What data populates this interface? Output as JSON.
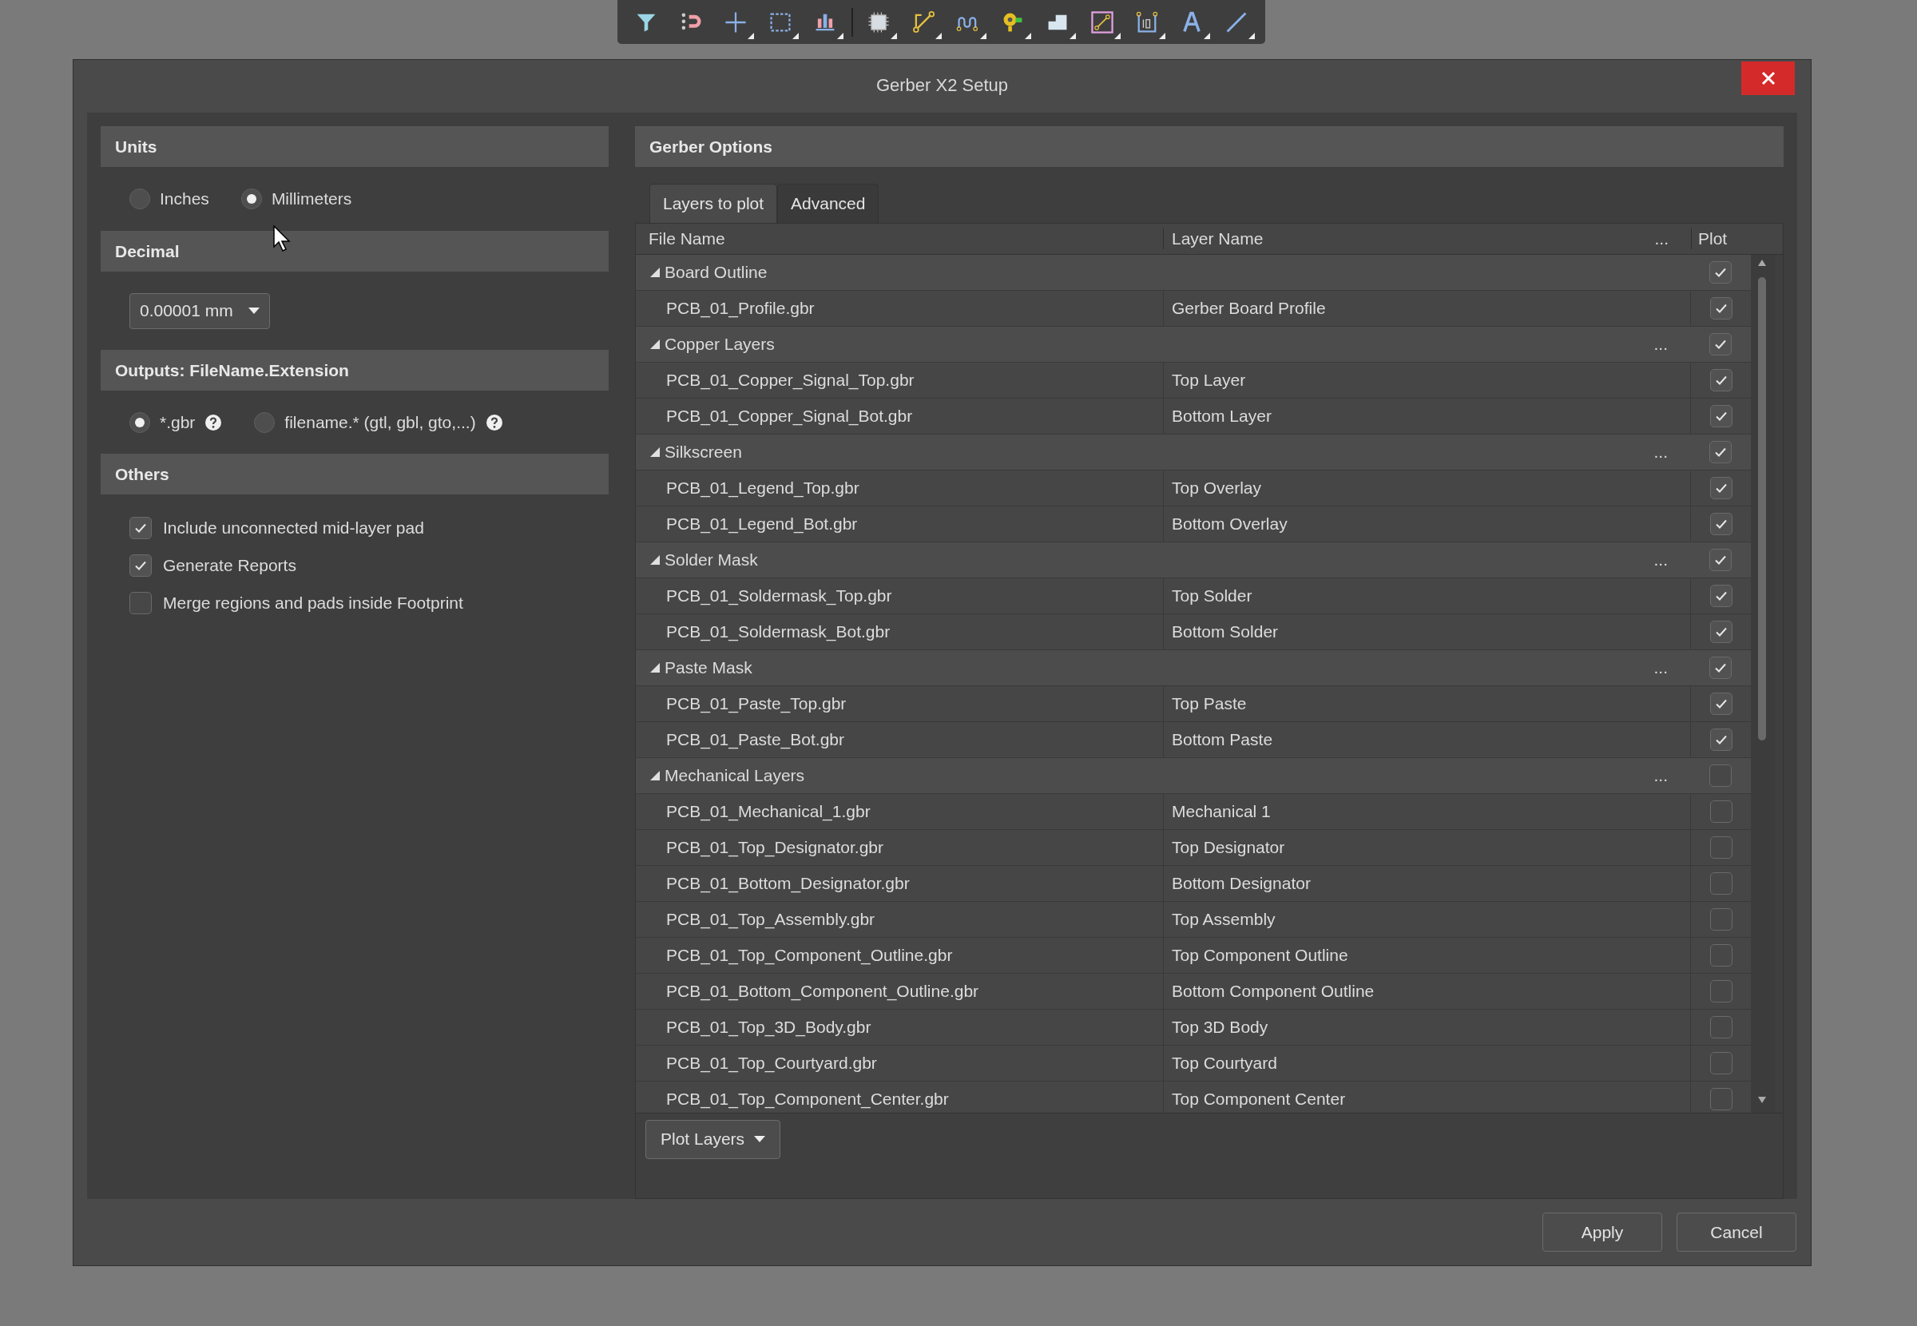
{
  "window": {
    "title": "Gerber X2 Setup"
  },
  "options": {
    "sections": [
      {
        "title": "Units",
        "kind": "radios",
        "options": [
          {
            "label": "Inches",
            "selected": false
          },
          {
            "label": "Millimeters",
            "selected": true
          }
        ]
      },
      {
        "title": "Decimal",
        "kind": "dropdown",
        "value": "0.00001 mm"
      },
      {
        "title": "Outputs: FileName.Extension",
        "kind": "radios",
        "options": [
          {
            "label": "*.gbr",
            "selected": true,
            "help": true
          },
          {
            "label": "filename.* (gtl, gbl, gto,...)",
            "selected": false,
            "help": true
          }
        ]
      },
      {
        "title": "Others",
        "kind": "checks",
        "items": [
          {
            "label": "Include unconnected mid-layer pad",
            "checked": true
          },
          {
            "label": "Generate Reports",
            "checked": true
          },
          {
            "label": "Merge regions and pads inside Footprint",
            "checked": false
          }
        ]
      }
    ]
  },
  "gerber": {
    "title": "Gerber Options",
    "tabs": [
      {
        "label": "Layers to plot",
        "selected": true
      },
      {
        "label": "Advanced",
        "selected": false
      }
    ],
    "columns": {
      "file": "File Name",
      "layer": "Layer Name",
      "more": "...",
      "plot": "Plot"
    },
    "groups": [
      {
        "name": "Board Outline",
        "expanded": true,
        "plot": true,
        "rows": [
          {
            "file": "PCB_01_Profile.gbr",
            "layer": "Gerber Board Profile",
            "plot": true
          }
        ]
      },
      {
        "name": "Copper Layers",
        "expanded": true,
        "plot": true,
        "more": "...",
        "rows": [
          {
            "file": "PCB_01_Copper_Signal_Top.gbr",
            "layer": "Top Layer",
            "plot": true
          },
          {
            "file": "PCB_01_Copper_Signal_Bot.gbr",
            "layer": "Bottom Layer",
            "plot": true
          }
        ]
      },
      {
        "name": "Silkscreen",
        "expanded": true,
        "plot": true,
        "more": "...",
        "rows": [
          {
            "file": "PCB_01_Legend_Top.gbr",
            "layer": "Top Overlay",
            "plot": true
          },
          {
            "file": "PCB_01_Legend_Bot.gbr",
            "layer": "Bottom Overlay",
            "plot": true
          }
        ]
      },
      {
        "name": "Solder Mask",
        "expanded": true,
        "plot": true,
        "more": "...",
        "rows": [
          {
            "file": "PCB_01_Soldermask_Top.gbr",
            "layer": "Top Solder",
            "plot": true
          },
          {
            "file": "PCB_01_Soldermask_Bot.gbr",
            "layer": "Bottom Solder",
            "plot": true
          }
        ]
      },
      {
        "name": "Paste Mask",
        "expanded": true,
        "plot": true,
        "more": "...",
        "rows": [
          {
            "file": "PCB_01_Paste_Top.gbr",
            "layer": "Top Paste",
            "plot": true
          },
          {
            "file": "PCB_01_Paste_Bot.gbr",
            "layer": "Bottom Paste",
            "plot": true
          }
        ]
      },
      {
        "name": "Mechanical Layers",
        "expanded": true,
        "plot": false,
        "more": "...",
        "rows": [
          {
            "file": "PCB_01_Mechanical_1.gbr",
            "layer": "Mechanical 1",
            "plot": false
          },
          {
            "file": "PCB_01_Top_Designator.gbr",
            "layer": "Top Designator",
            "plot": false
          },
          {
            "file": "PCB_01_Bottom_Designator.gbr",
            "layer": "Bottom Designator",
            "plot": false
          },
          {
            "file": "PCB_01_Top_Assembly.gbr",
            "layer": "Top Assembly",
            "plot": false
          },
          {
            "file": "PCB_01_Top_Component_Outline.gbr",
            "layer": "Top Component Outline",
            "plot": false
          },
          {
            "file": "PCB_01_Bottom_Component_Outline.gbr",
            "layer": "Bottom Component Outline",
            "plot": false
          },
          {
            "file": "PCB_01_Top_3D_Body.gbr",
            "layer": "Top 3D Body",
            "plot": false
          },
          {
            "file": "PCB_01_Top_Courtyard.gbr",
            "layer": "Top Courtyard",
            "plot": false
          },
          {
            "file": "PCB_01_Top_Component_Center.gbr",
            "layer": "Top Component Center",
            "plot": false
          }
        ]
      }
    ],
    "menu_button": "Plot Layers"
  },
  "buttons": [
    {
      "label": "Apply"
    },
    {
      "label": "Cancel"
    }
  ]
}
